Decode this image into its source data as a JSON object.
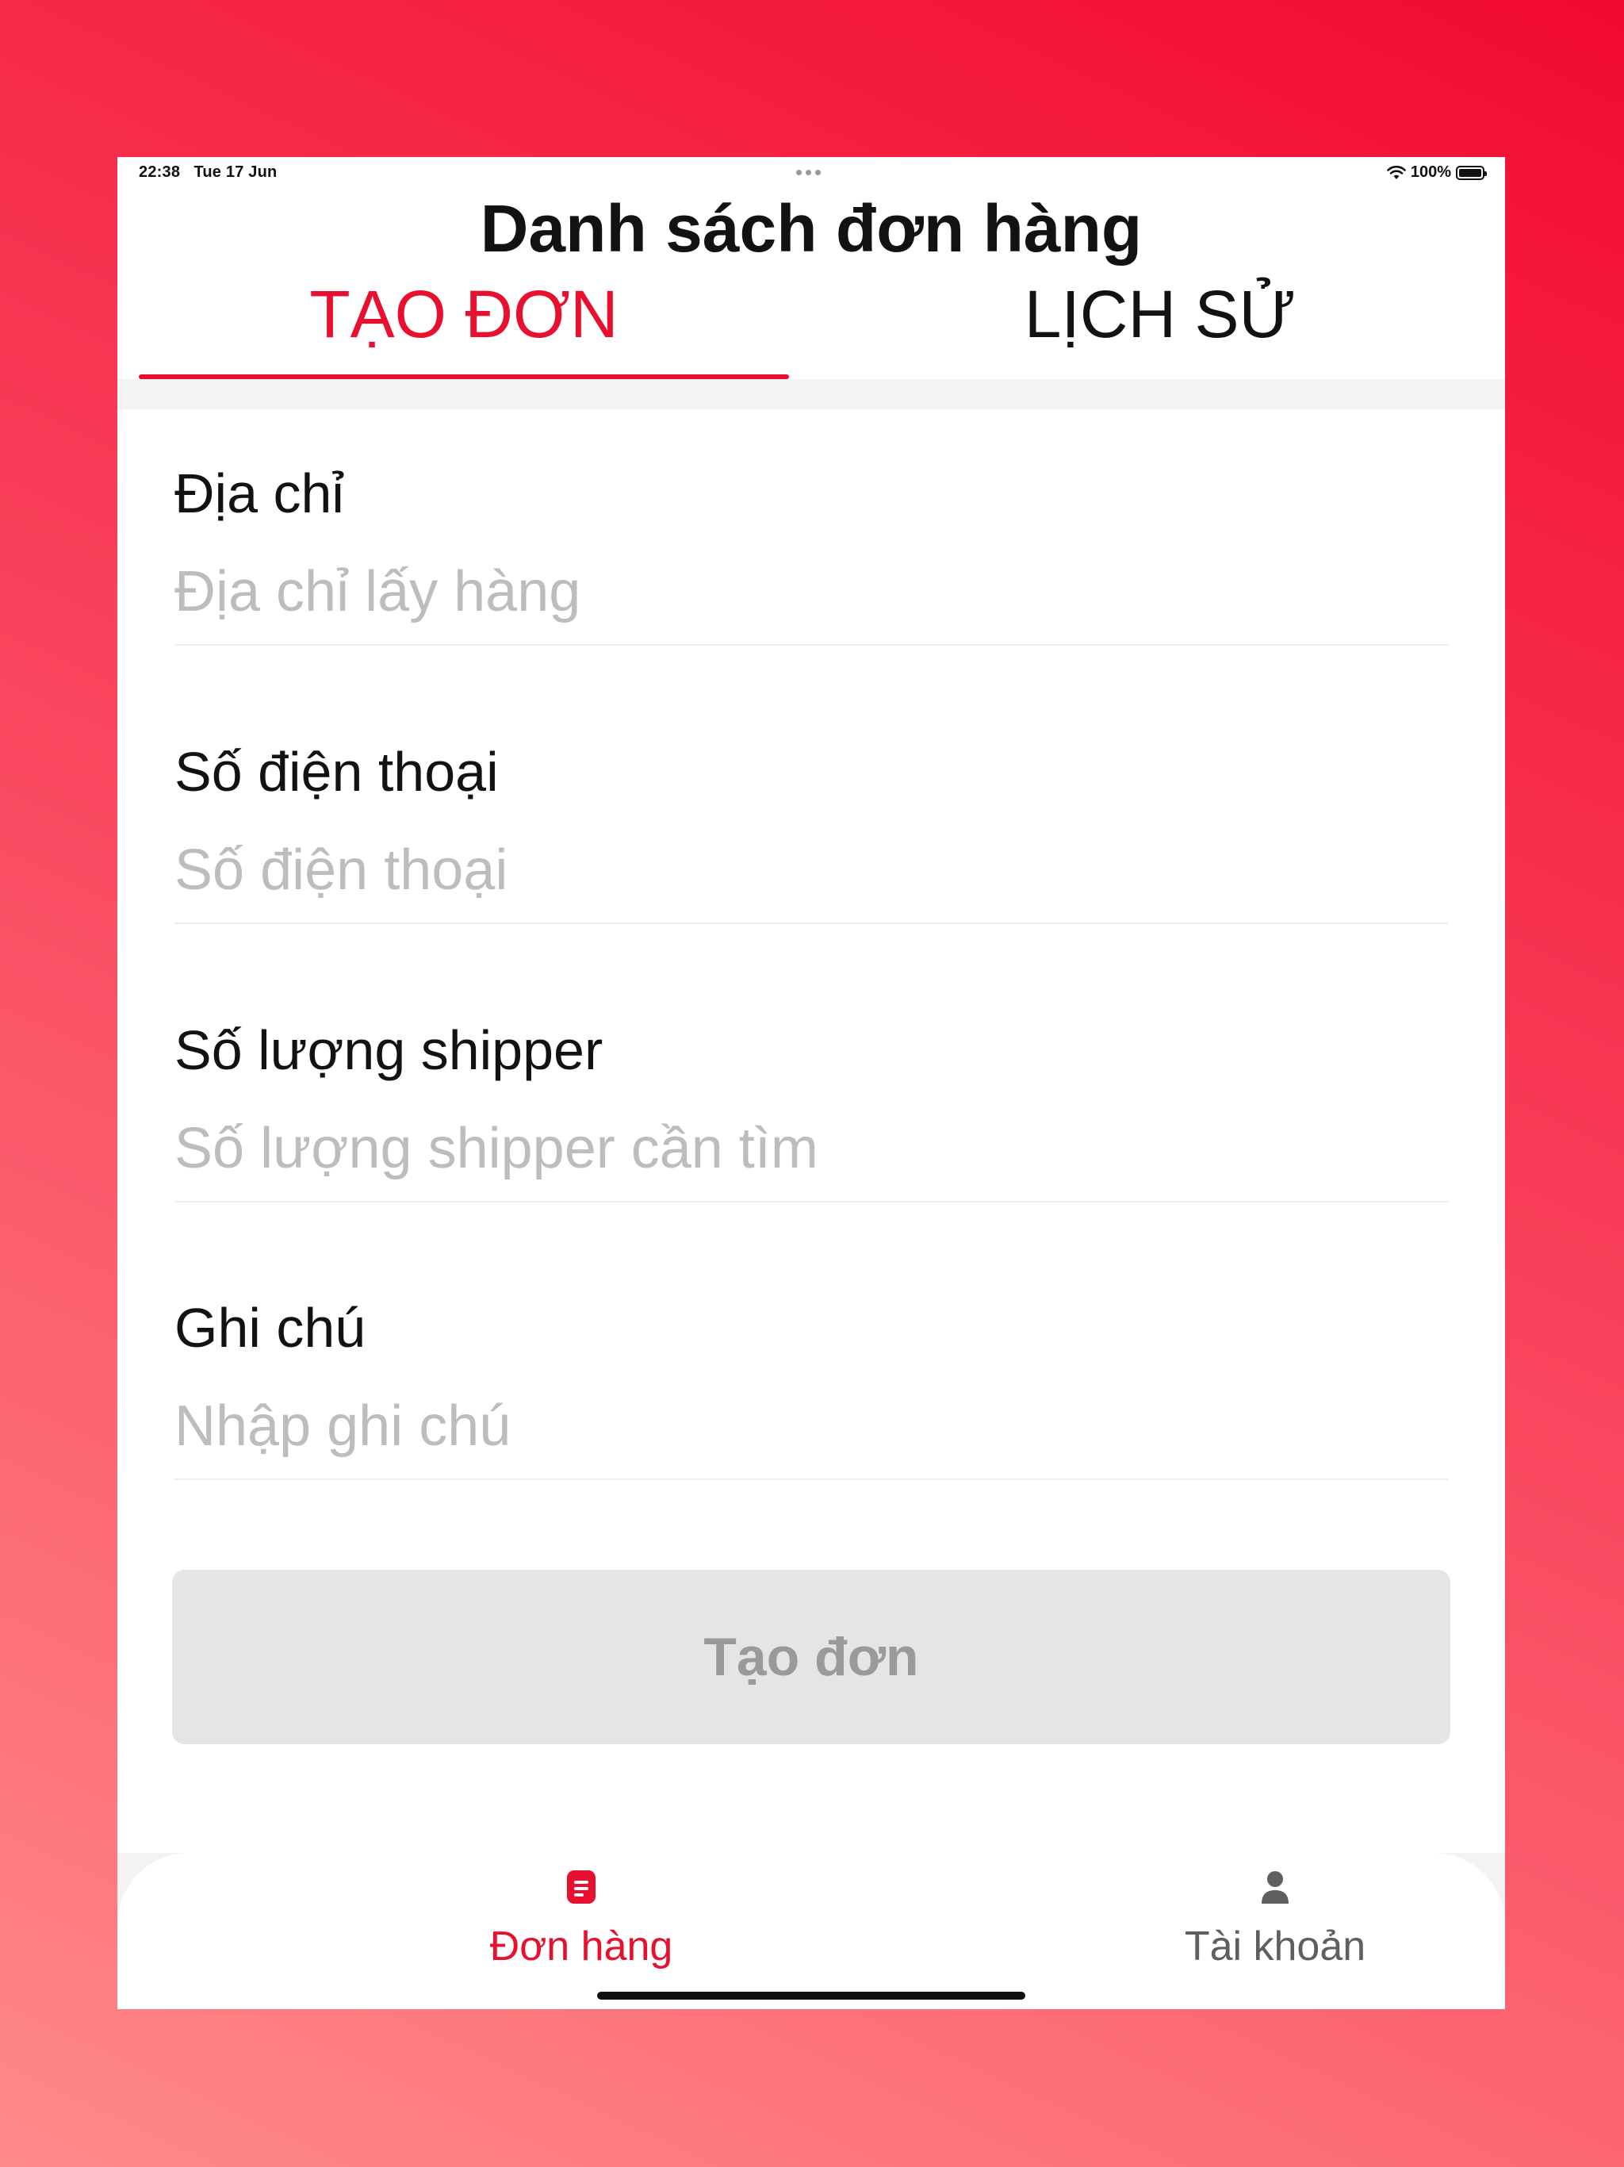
{
  "status_bar": {
    "time": "22:38",
    "date": "Tue 17 Jun",
    "battery": "100%",
    "battery_level": 1.0,
    "icons": [
      "wifi-icon",
      "battery-icon",
      "multitasking-dots-icon"
    ]
  },
  "header": {
    "title": "Danh sách đơn hàng",
    "tabs": [
      {
        "label": "TẠO ĐƠN",
        "active": true
      },
      {
        "label": "LỊCH SỬ",
        "active": false
      }
    ]
  },
  "form": {
    "fields": [
      {
        "label": "Địa chỉ",
        "value": "",
        "placeholder": "Địa chỉ lấy hàng"
      },
      {
        "label": "Số điện thoại",
        "value": "",
        "placeholder": "Số điện thoại"
      },
      {
        "label": "Số lượng shipper",
        "value": "",
        "placeholder": "Số lượng shipper cần tìm"
      },
      {
        "label": "Ghi chú",
        "value": "",
        "placeholder": "Nhập ghi chú"
      }
    ],
    "submit_label": "Tạo đơn",
    "submit_enabled": false
  },
  "bottom_nav": {
    "items": [
      {
        "label": "Đơn hàng",
        "icon": "document-icon",
        "active": true
      },
      {
        "label": "Tài khoản",
        "icon": "user-icon",
        "active": false
      }
    ]
  },
  "colors": {
    "accent": "#e8102e",
    "text": "#121212",
    "placeholder": "#bdbdbd",
    "button_disabled_bg": "#e5e5e5",
    "button_disabled_text": "#9a9a9a",
    "inactive_nav": "#5f5f5f"
  }
}
